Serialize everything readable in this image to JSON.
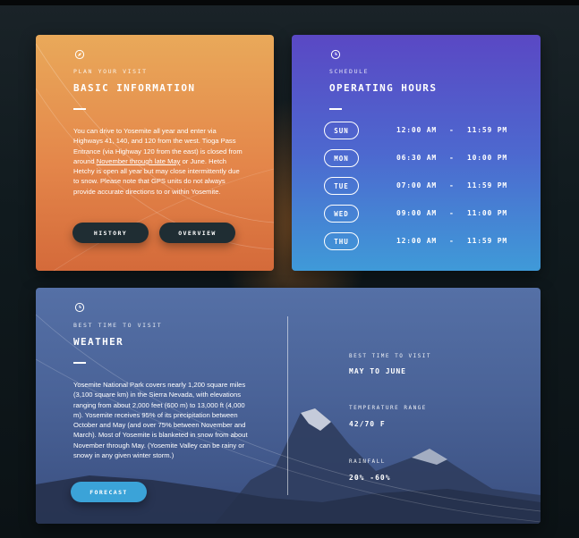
{
  "basic_info": {
    "icon": "compass-icon",
    "eyebrow": "PLAN YOUR VISIT",
    "title": "BASIC INFORMATION",
    "text_before_link": "You can drive to Yosemite all year and enter via Highways 41, 140, and 120 from the west. Tioga Pass Entrance (via Highway 120 from the east) is closed from around ",
    "link_text": "November through late May",
    "text_after_link": " or June. Hetch Hetchy is open all year but may close intermittently due to snow. Please note that GPS units do not always provide accurate directions to or within Yosemite.",
    "buttons": {
      "history": "HISTORY",
      "overview": "OVERVIEW"
    },
    "accent_color": "#e4864a"
  },
  "hours": {
    "icon": "clock-icon",
    "eyebrow": "SCHEDULE",
    "title": "OPERATING HOURS",
    "separator": "-",
    "rows": [
      {
        "day": "SUN",
        "open": "12:00 AM",
        "close": "11:59 PM"
      },
      {
        "day": "MON",
        "open": "06:30 AM",
        "close": "10:00 PM"
      },
      {
        "day": "TUE",
        "open": "07:00 AM",
        "close": "11:59 PM"
      },
      {
        "day": "WED",
        "open": "09:00 AM",
        "close": "11:00 PM"
      },
      {
        "day": "THU",
        "open": "12:00 AM",
        "close": "11:59 PM"
      }
    ],
    "accent_color": "#5a48c4"
  },
  "weather": {
    "icon": "clock-icon",
    "eyebrow": "BEST TIME TO VISIT",
    "title": "WEATHER",
    "text": "Yosemite National Park covers nearly 1,200 square miles (3,100 square km) in the Sierra Nevada, with elevations ranging from about 2,000 feet (600 m) to 13,000 ft (4,000 m). Yosemite receives 95% of its precipitation between October and May (and over 75% between November and March). Most of Yosemite is blanketed in snow from about November through May. (Yosemite Valley can be rainy or snowy in any given winter storm.)",
    "forecast_button": "FORECAST",
    "stats": [
      {
        "label": "BEST TIME TO VISIT",
        "value": "MAY TO JUNE"
      },
      {
        "label": "TEMPERATURE RANGE",
        "value": "42/70 F"
      },
      {
        "label": "RAINFALL",
        "value": "20% -60%"
      }
    ],
    "button_color": "#3ba3d8"
  }
}
